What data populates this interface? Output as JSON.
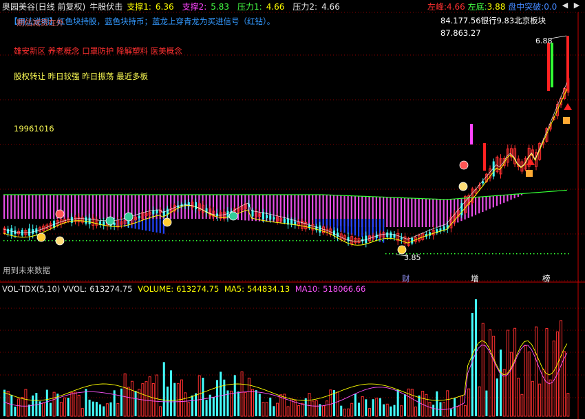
{
  "header": {
    "stock_name": "奥园美谷(日线 前复权)",
    "indicator_name": "牛股伏击",
    "support1_label": "支撑1:",
    "support1_value": "6.36",
    "support2_label": "支撑2:",
    "support2_value": "5.83",
    "pressure1_label": "压力1:",
    "pressure1_value": "4.66",
    "pressure2_label": "压力2:",
    "pressure2_value": "4.66",
    "left_peak_label": "左峰:",
    "left_peak_value": "4.66",
    "left_bottom_label": "左底:",
    "left_bottom_value": "3.88",
    "breakout_label": "盘中突破:",
    "breakout_value": "0.0"
  },
  "notes": {
    "usage_text": "【用法说明】红色块持股，蓝色块持币；蓝龙上穿青龙为买进信号（红钻）。",
    "overlay_text": "期估减资在外",
    "concepts": "雄安新区 养老概念 口罩防护 降解塑料 医美概念",
    "tags": "股权转让 昨日较强 昨日振荡 最近多板",
    "listing_date": "19961016",
    "sector_line": "84.177.56银行9.83北京板块",
    "sector_value": "87.863.27",
    "future_data": "用到未来数据",
    "high_price_label": "6.88",
    "low_price_label": "3.85",
    "event_cai": "财",
    "event_zeng": "增",
    "event_bang": "榜"
  },
  "volume": {
    "title": "VOL-TDX(5,10)",
    "vvol_label": "VVOL:",
    "vvol_value": "613274.75",
    "volume_label": "VOLUME:",
    "volume_value": "613274.75",
    "ma5_label": "MA5:",
    "ma5_value": "544834.13",
    "ma10_label": "MA10:",
    "ma10_value": "518066.66"
  },
  "colors": {
    "up": "#ff3030",
    "down": "#44ffff",
    "yellow": "#ffff00",
    "magenta": "#ff55ff",
    "blue_bar": "#2244ff",
    "green_line": "#33ff33",
    "grid": "#8b0000"
  },
  "icons": [
    "settings-icon",
    "fullscreen-icon",
    "prev-arrow-icon",
    "next-arrow-icon"
  ]
}
